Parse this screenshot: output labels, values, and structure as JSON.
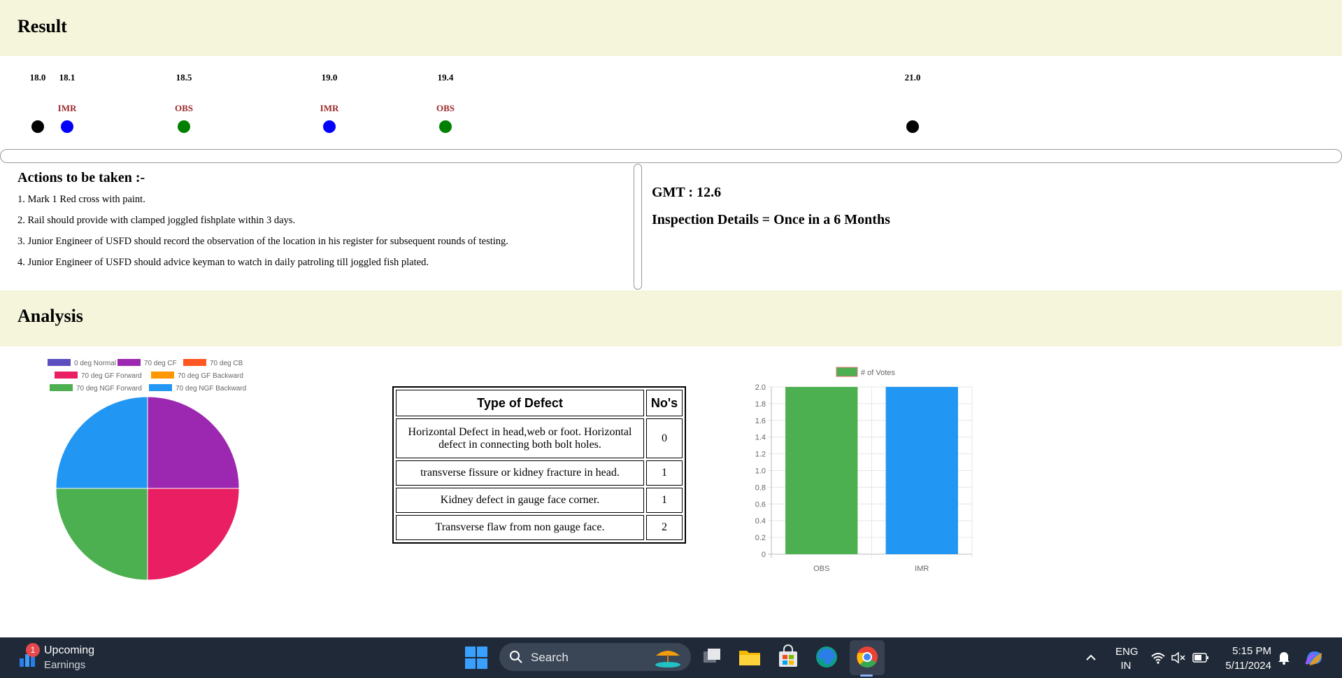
{
  "result": {
    "heading": "Result"
  },
  "timeline": [
    {
      "value": "18.0",
      "label": "",
      "color": "#000000",
      "pos": 54
    },
    {
      "value": "18.1",
      "label": "IMR",
      "color": "#0000ff",
      "pos": 96
    },
    {
      "value": "18.5",
      "label": "OBS",
      "color": "#008000",
      "pos": 263
    },
    {
      "value": "19.0",
      "label": "IMR",
      "color": "#0000ff",
      "pos": 471
    },
    {
      "value": "19.4",
      "label": "OBS",
      "color": "#008000",
      "pos": 637
    },
    {
      "value": "21.0",
      "label": "",
      "color": "#000000",
      "pos": 1305
    }
  ],
  "actions": {
    "heading": "Actions to be taken :-",
    "items": [
      "1. Mark 1 Red cross with paint.",
      "2. Rail should provide with clamped joggled fishplate within 3 days.",
      "3. Junior Engineer of USFD should record the observation of the location in his register for subsequent rounds of testing.",
      "4. Junior Engineer of USFD should advice keyman to watch in daily patroling till joggled fish plated."
    ]
  },
  "gmt": {
    "text": "GMT : 12.6"
  },
  "inspection": {
    "text": "Inspection Details = Once in a 6 Months"
  },
  "analysis": {
    "heading": "Analysis"
  },
  "defect_table": {
    "headers": [
      "Type of Defect",
      "No's"
    ],
    "rows": [
      [
        "Horizontal Defect in head,web or foot. Horizontal defect in connecting both bolt holes.",
        "0"
      ],
      [
        "transverse fissure or kidney fracture in head.",
        "1"
      ],
      [
        "Kidney defect in gauge face corner.",
        "1"
      ],
      [
        "Transverse flaw from non gauge face.",
        "2"
      ]
    ]
  },
  "chart_data": [
    {
      "type": "pie",
      "legend": [
        {
          "name": "0 deg Normal",
          "color": "#5b4fbf"
        },
        {
          "name": "70 deg CF",
          "color": "#9c27b0"
        },
        {
          "name": "70 deg CB",
          "color": "#ff5722"
        },
        {
          "name": "70 deg GF Forward",
          "color": "#e91e63"
        },
        {
          "name": "70 deg GF Backward",
          "color": "#ff9800"
        },
        {
          "name": "70 deg NGF Forward",
          "color": "#4caf50"
        },
        {
          "name": "70 deg NGF Backward",
          "color": "#2196f3"
        }
      ],
      "slices": [
        {
          "name": "0 deg Normal",
          "value": 0
        },
        {
          "name": "70 deg CF",
          "value": 1
        },
        {
          "name": "70 deg CB",
          "value": 0
        },
        {
          "name": "70 deg GF Forward",
          "value": 1
        },
        {
          "name": "70 deg GF Backward",
          "value": 0
        },
        {
          "name": "70 deg NGF Forward",
          "value": 1
        },
        {
          "name": "70 deg NGF Backward",
          "value": 1
        }
      ]
    },
    {
      "type": "bar",
      "legend": "# of Votes",
      "categories": [
        "OBS",
        "IMR"
      ],
      "values": [
        2,
        2
      ],
      "colors": [
        "#4caf50",
        "#2196f3"
      ],
      "ylim": [
        0,
        2
      ],
      "yticks": [
        "0",
        "0.2",
        "0.4",
        "0.6",
        "0.8",
        "1.0",
        "1.2",
        "1.4",
        "1.6",
        "1.8",
        "2.0"
      ],
      "grid": true
    }
  ],
  "taskbar": {
    "widget_badge": "1",
    "widget_title": "Upcoming",
    "widget_subtitle": "Earnings",
    "search_label": "Search",
    "lang_line1": "ENG",
    "lang_line2": "IN",
    "time": "5:15 PM",
    "date": "5/11/2024",
    "icons": [
      "start-icon",
      "search-icon",
      "task-view-icon",
      "file-explorer-icon",
      "store-icon",
      "edge-icon",
      "chrome-icon",
      "chevron-up-icon",
      "wifi-icon",
      "volume-muted-icon",
      "battery-icon",
      "bell-icon",
      "copilot-icon"
    ]
  }
}
